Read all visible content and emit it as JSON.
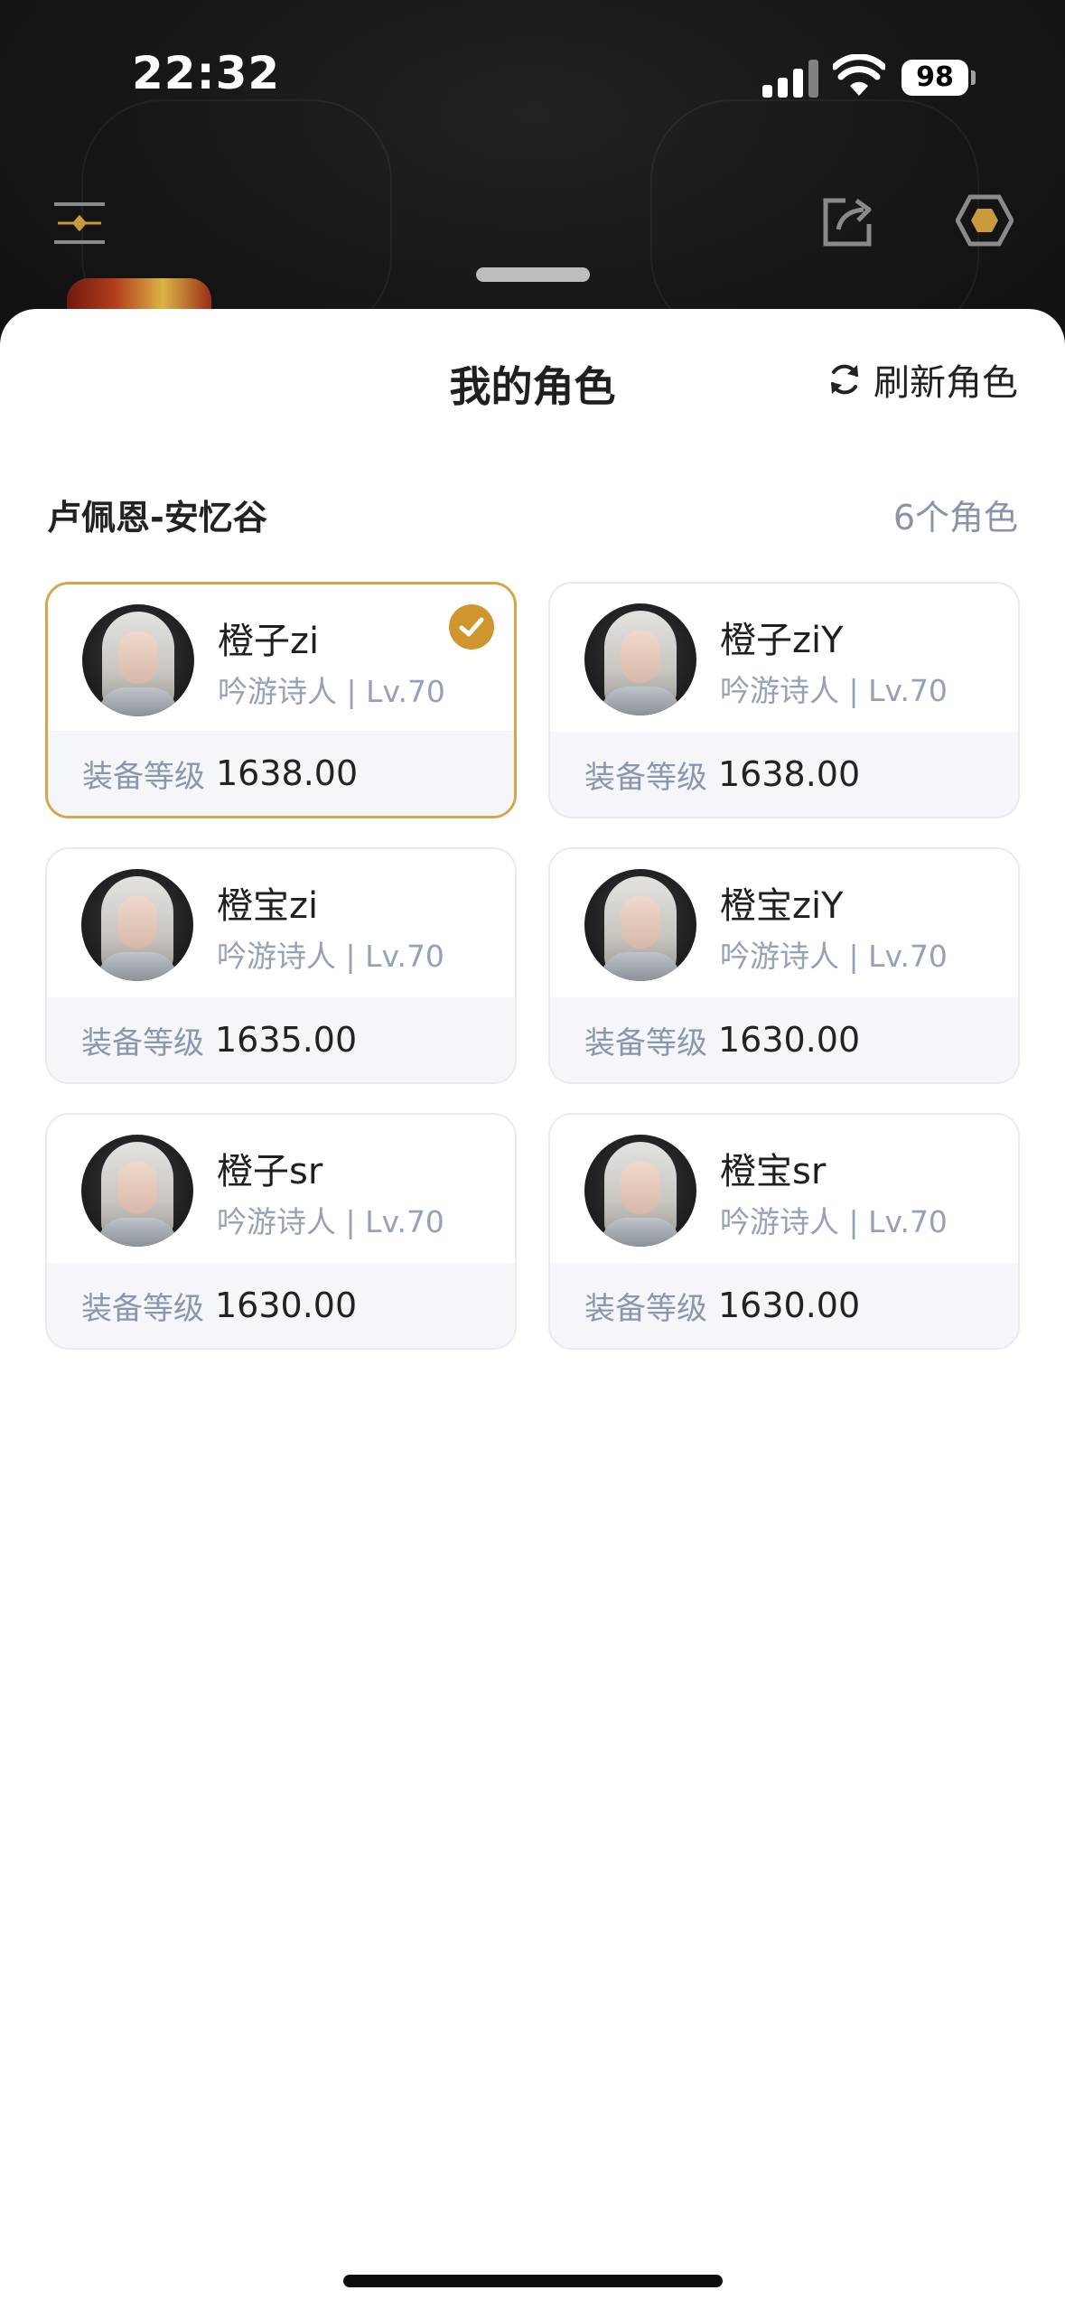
{
  "status_bar": {
    "time": "22:32",
    "battery": "98"
  },
  "header_icons": {
    "left": "menu-filter-icon",
    "share": "share-icon",
    "settings": "hexagon-settings-icon"
  },
  "sheet": {
    "title": "我的角色",
    "refresh_label": "刷新角色",
    "server_name": "卢佩恩-安忆谷",
    "character_count": "6个角色",
    "item_level_label": "装备等级"
  },
  "characters": [
    {
      "name": "橙子zi",
      "class_level": "吟游诗人 | Lv.70",
      "item_level": "1638.00",
      "selected": true
    },
    {
      "name": "橙子ziY",
      "class_level": "吟游诗人 | Lv.70",
      "item_level": "1638.00",
      "selected": false
    },
    {
      "name": "橙宝zi",
      "class_level": "吟游诗人 | Lv.70",
      "item_level": "1635.00",
      "selected": false
    },
    {
      "name": "橙宝ziY",
      "class_level": "吟游诗人 | Lv.70",
      "item_level": "1630.00",
      "selected": false
    },
    {
      "name": "橙子sr",
      "class_level": "吟游诗人 | Lv.70",
      "item_level": "1630.00",
      "selected": false
    },
    {
      "name": "橙宝sr",
      "class_level": "吟游诗人 | Lv.70",
      "item_level": "1630.00",
      "selected": false
    }
  ],
  "colors": {
    "selected_border": "#d6a64a",
    "check_badge": "#cf952f",
    "muted_text": "#96a0b6"
  }
}
